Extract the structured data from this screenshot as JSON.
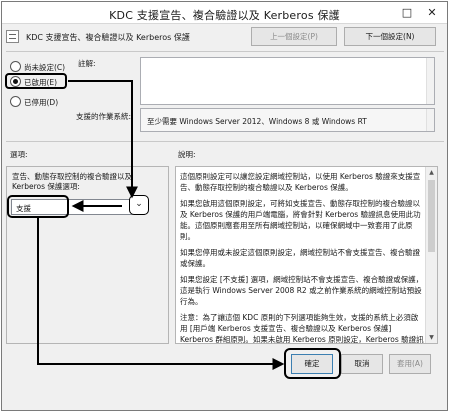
{
  "window": {
    "title": "KDC 支援宣告、複合驗證以及 Kerberos 保護",
    "maximize_glyph": "□",
    "close_glyph": "✕"
  },
  "header": {
    "policy_name": "KDC 支援宣告、複合驗證以及 Kerberos 保護",
    "prev_button": "上一個設定(P)",
    "next_button": "下一個設定(N)"
  },
  "state_options": {
    "not_configured": "尚未設定(C)",
    "enabled": "已啟用(E)",
    "disabled": "已停用(D)",
    "selected": "enabled"
  },
  "comment": {
    "label": "註解:",
    "value": ""
  },
  "supported_on": {
    "label": "支援的作業系統:",
    "value": "至少需要 Windows Server 2012、Windows 8 或 Windows RT"
  },
  "options": {
    "section_label": "選項:",
    "field_label": "宣告、動態存取控制的複合驗證以及 Kerberos 保護選項:",
    "selected_value": "支援",
    "dropdown_glyph": "⌄"
  },
  "help": {
    "section_label": "說明:",
    "paragraphs": [
      "這個原則設定可以讓您設定網域控制站，以使用 Kerberos 驗證來支援宣告、動態存取控制的複合驗證以及 Kerberos 保護。",
      "如果您啟用這個原則設定，可將如支援宣告、動態存取控制的複合驗證以及 Kerberos 保護的用戶端電腦，將會針對 Kerberos 驗證訊息使用此功能。這個原則應套用至所有網域控制站，以確保網域中一致套用了此原則。",
      "如果您停用或未設定這個原則設定，網域控制站不會支援宣告、複合驗證或保護。",
      "如果您設定 [不支援] 選項，網域控制站不會支援宣告、複合驗證或保護，這是執行 Windows Server 2008 R2 或之前作業系統的網域控制站預設行為。",
      "注意：為了讓這個 KDC 原則的下列選項能夠生效，支援的系統上必須啟用 [用戶端 Kerberos 支援宣告、複合驗證以及 Kerberos 保護] Kerberos 群組原則。如果未啟用 Kerberos 原則設定，Kerberos 驗證訊息將不會使用這些功能。"
    ],
    "scroll_up": "▲",
    "scroll_down": "▼"
  },
  "footer": {
    "ok": "確定",
    "cancel": "取消",
    "apply": "套用(A)"
  }
}
